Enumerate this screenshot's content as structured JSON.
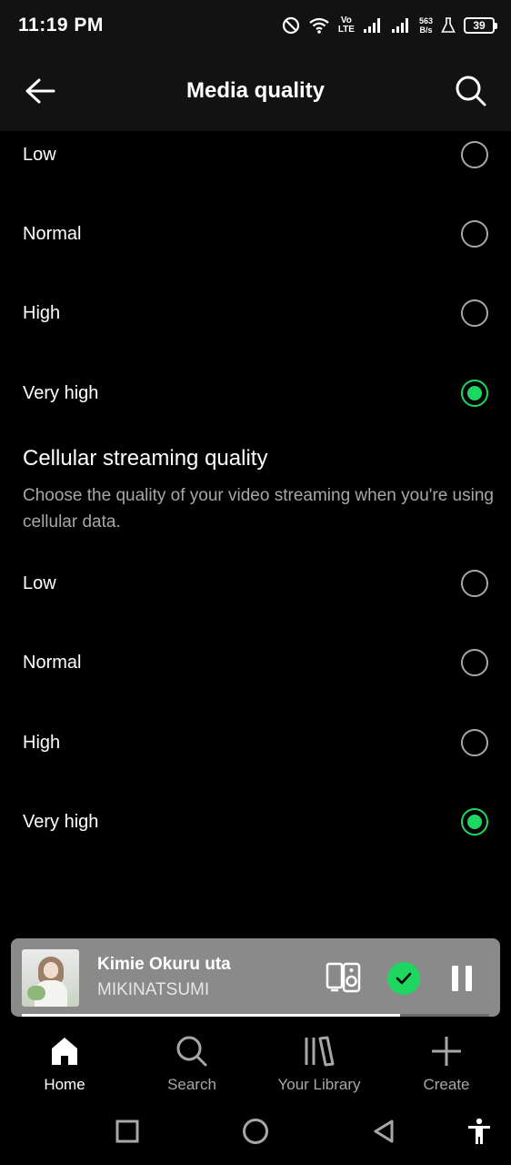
{
  "status_bar": {
    "time": "11:19 PM",
    "volte_top": "Vo",
    "volte_bottom": "LTE",
    "speed_value": "563",
    "speed_unit": "B/s",
    "battery": "39",
    "icons": [
      "do-not-disturb-icon",
      "wifi-icon",
      "signal-icon",
      "signal-icon",
      "flask-icon",
      "battery-icon"
    ]
  },
  "header": {
    "title": "Media quality",
    "back_icon": "arrow-left-icon",
    "search_icon": "search-icon"
  },
  "wifi_quality": {
    "options": [
      {
        "label": "Low",
        "selected": false
      },
      {
        "label": "Normal",
        "selected": false
      },
      {
        "label": "High",
        "selected": false
      },
      {
        "label": "Very high",
        "selected": true
      }
    ]
  },
  "cellular_quality": {
    "title": "Cellular streaming quality",
    "description": "Choose the quality of your video streaming when you're using cellular data.",
    "options": [
      {
        "label": "Low",
        "selected": false
      },
      {
        "label": "Normal",
        "selected": false
      },
      {
        "label": "High",
        "selected": false
      },
      {
        "label": "Very high",
        "selected": true
      }
    ]
  },
  "mini_player": {
    "track_title": "Kimie Okuru uta",
    "artist": "MIKINATSUMI",
    "progress_fraction": 0.81,
    "liked": true,
    "state": "playing"
  },
  "bottom_nav": {
    "items": [
      {
        "label": "Home",
        "icon": "home-icon",
        "active": true
      },
      {
        "label": "Search",
        "icon": "search-icon",
        "active": false
      },
      {
        "label": "Your Library",
        "icon": "library-icon",
        "active": false
      },
      {
        "label": "Create",
        "icon": "plus-icon",
        "active": false
      }
    ]
  },
  "colors": {
    "accent": "#1ed760",
    "background": "#000000",
    "header_background": "#121212",
    "secondary_text": "#a7a7a7",
    "mini_player_background": "#8a8a8a"
  }
}
